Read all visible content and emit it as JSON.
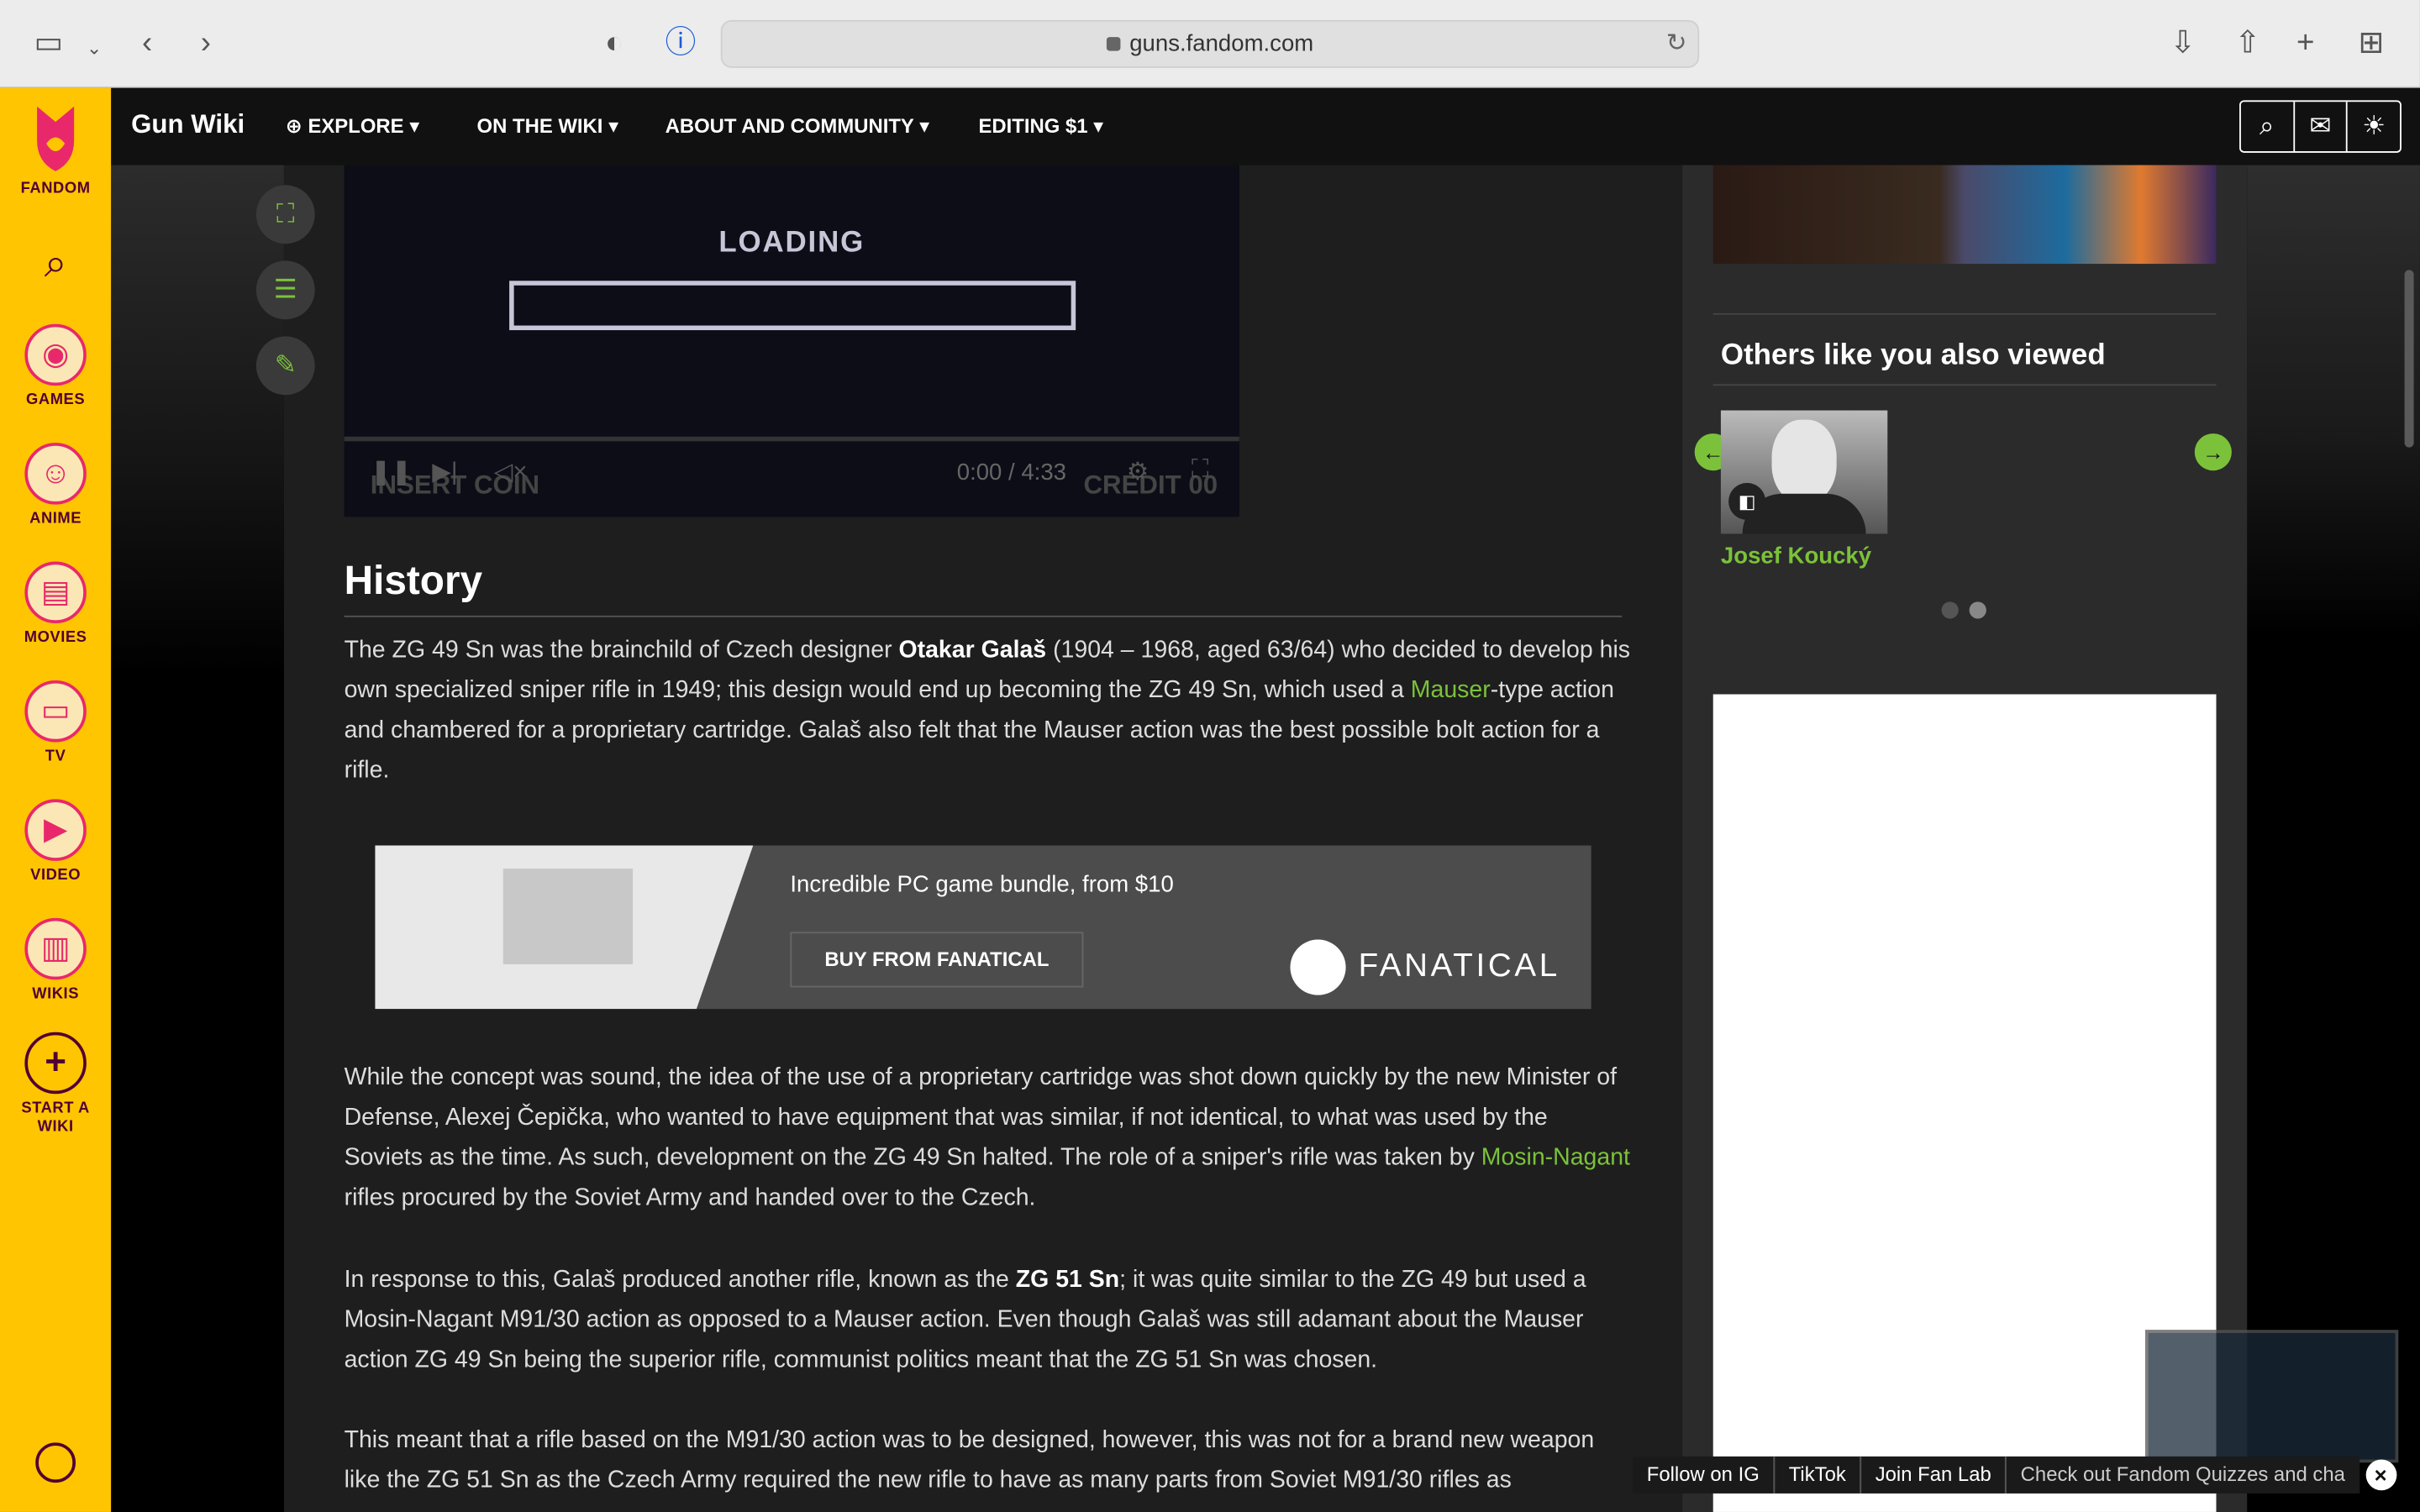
{
  "browser": {
    "url": "guns.fandom.com",
    "icons": [
      "sidebar-icon",
      "chevron-down-icon",
      "back-icon",
      "forward-icon",
      "shield-icon",
      "password-icon",
      "download-icon",
      "share-icon",
      "new-tab-icon",
      "tab-overview-icon"
    ]
  },
  "rail": {
    "logo_label": "FANDOM",
    "items": [
      {
        "label": "GAMES",
        "icon": "game-controller-icon"
      },
      {
        "label": "ANIME",
        "icon": "anime-icon"
      },
      {
        "label": "MOVIES",
        "icon": "clapperboard-icon"
      },
      {
        "label": "TV",
        "icon": "tv-icon"
      },
      {
        "label": "VIDEO",
        "icon": "play-icon"
      },
      {
        "label": "WIKIS",
        "icon": "book-icon"
      }
    ],
    "start_wiki": "START A WIKI"
  },
  "wikinav": {
    "title": "Gun Wiki",
    "explore": "EXPLORE",
    "on_the_wiki": "ON THE WIKI",
    "about": "ABOUT AND COMMUNITY",
    "editing": "EDITING $1"
  },
  "video": {
    "loading": "LOADING",
    "insert_coin": "INSERT COIN",
    "credit": "CREDIT 00",
    "time": "0:00 / 4:33"
  },
  "article": {
    "heading": "History",
    "p1_a": "The ZG 49 Sn was the brainchild of Czech designer ",
    "p1_bold": "Otakar Galaš",
    "p1_b": " (1904 – 1968, aged 63/64) who decided to develop his own specialized sniper rifle in 1949; this design would end up becoming the ZG 49 Sn, which used a ",
    "p1_link": "Mauser",
    "p1_c": "-type action and chambered for a proprietary cartridge. Galaš also felt that the Mauser action was the best possible bolt action for a rifle.",
    "p2_a": "While the concept was sound, the idea of the use of a proprietary cartridge was shot down quickly by the new Minister of Defense, Alexej Čepička, who wanted to have equipment that was similar, if not identical, to what was used by the Soviets as the time. As such, development on the ZG 49 Sn halted. The role of a sniper's rifle was taken by ",
    "p2_link": "Mosin-Nagant",
    "p2_b": " rifles procured by the Soviet Army and handed over to the Czech.",
    "p3_a": "In response to this, Galaš produced another rifle, known as the ",
    "p3_bold": "ZG 51 Sn",
    "p3_b": "; it was quite similar to the ZG 49 but used a Mosin-Nagant M91/30 action as opposed to a Mauser action. Even though Galaš was still adamant about the Mauser action ZG 49 Sn being the superior rifle, communist politics meant that the ZG 51 Sn was chosen.",
    "p4": "This meant that a rifle based on the M91/30 action was to be designed, however, this was not for a brand new weapon like the ZG 51 Sn as the Czech Army required the new rifle to have as many parts from Soviet M91/30 rifles as"
  },
  "ad": {
    "headline": "Incredible PC game bundle, from $10",
    "button": "BUY FROM FANATICAL",
    "brand": "FANATICAL"
  },
  "sidebar": {
    "title": "Others like you also viewed",
    "card_name": "Josef Koucký"
  },
  "bottom_bar": {
    "items": [
      "Follow on IG",
      "TikTok",
      "Join Fan Lab",
      "Check out Fandom Quizzes and cha"
    ]
  },
  "colors": {
    "fandom_yellow": "#ffc500",
    "link_green": "#7bc23a",
    "fandom_pink": "#e9286b"
  }
}
